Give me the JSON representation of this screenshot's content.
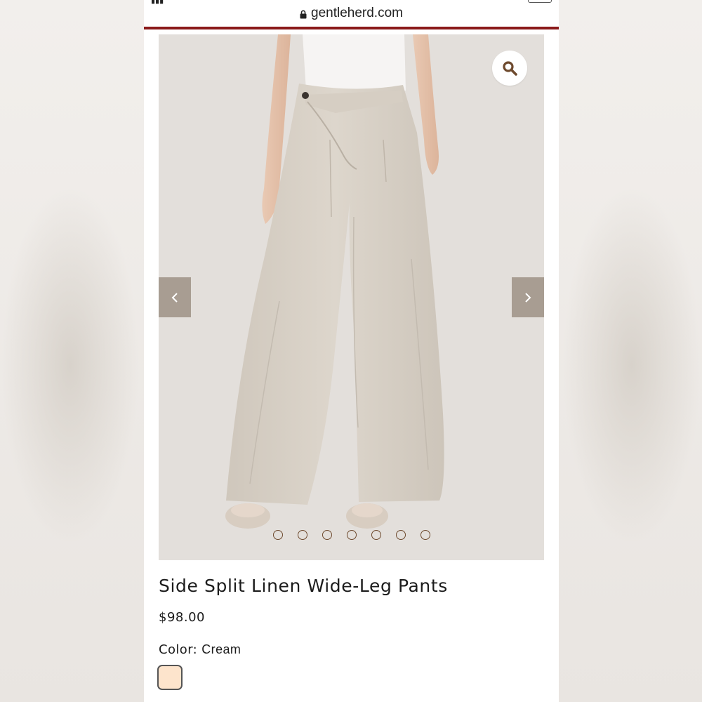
{
  "browser": {
    "url": "gentleherd.com"
  },
  "gallery": {
    "slide_count": 7,
    "zoom_icon": "magnifier-icon",
    "prev_icon": "chevron-left-icon",
    "next_icon": "chevron-right-icon"
  },
  "product": {
    "title": "Side Split Linen Wide-Leg Pants",
    "price": "$98.00",
    "color_label": "Color:",
    "color_value": "Cream",
    "swatch_color": "#fde4cc"
  },
  "colors": {
    "accent": "#8b1a1a",
    "arrow_bg": "#a89d92",
    "dot_border": "#6e4a2e",
    "zoom_icon": "#6e4a2e"
  }
}
